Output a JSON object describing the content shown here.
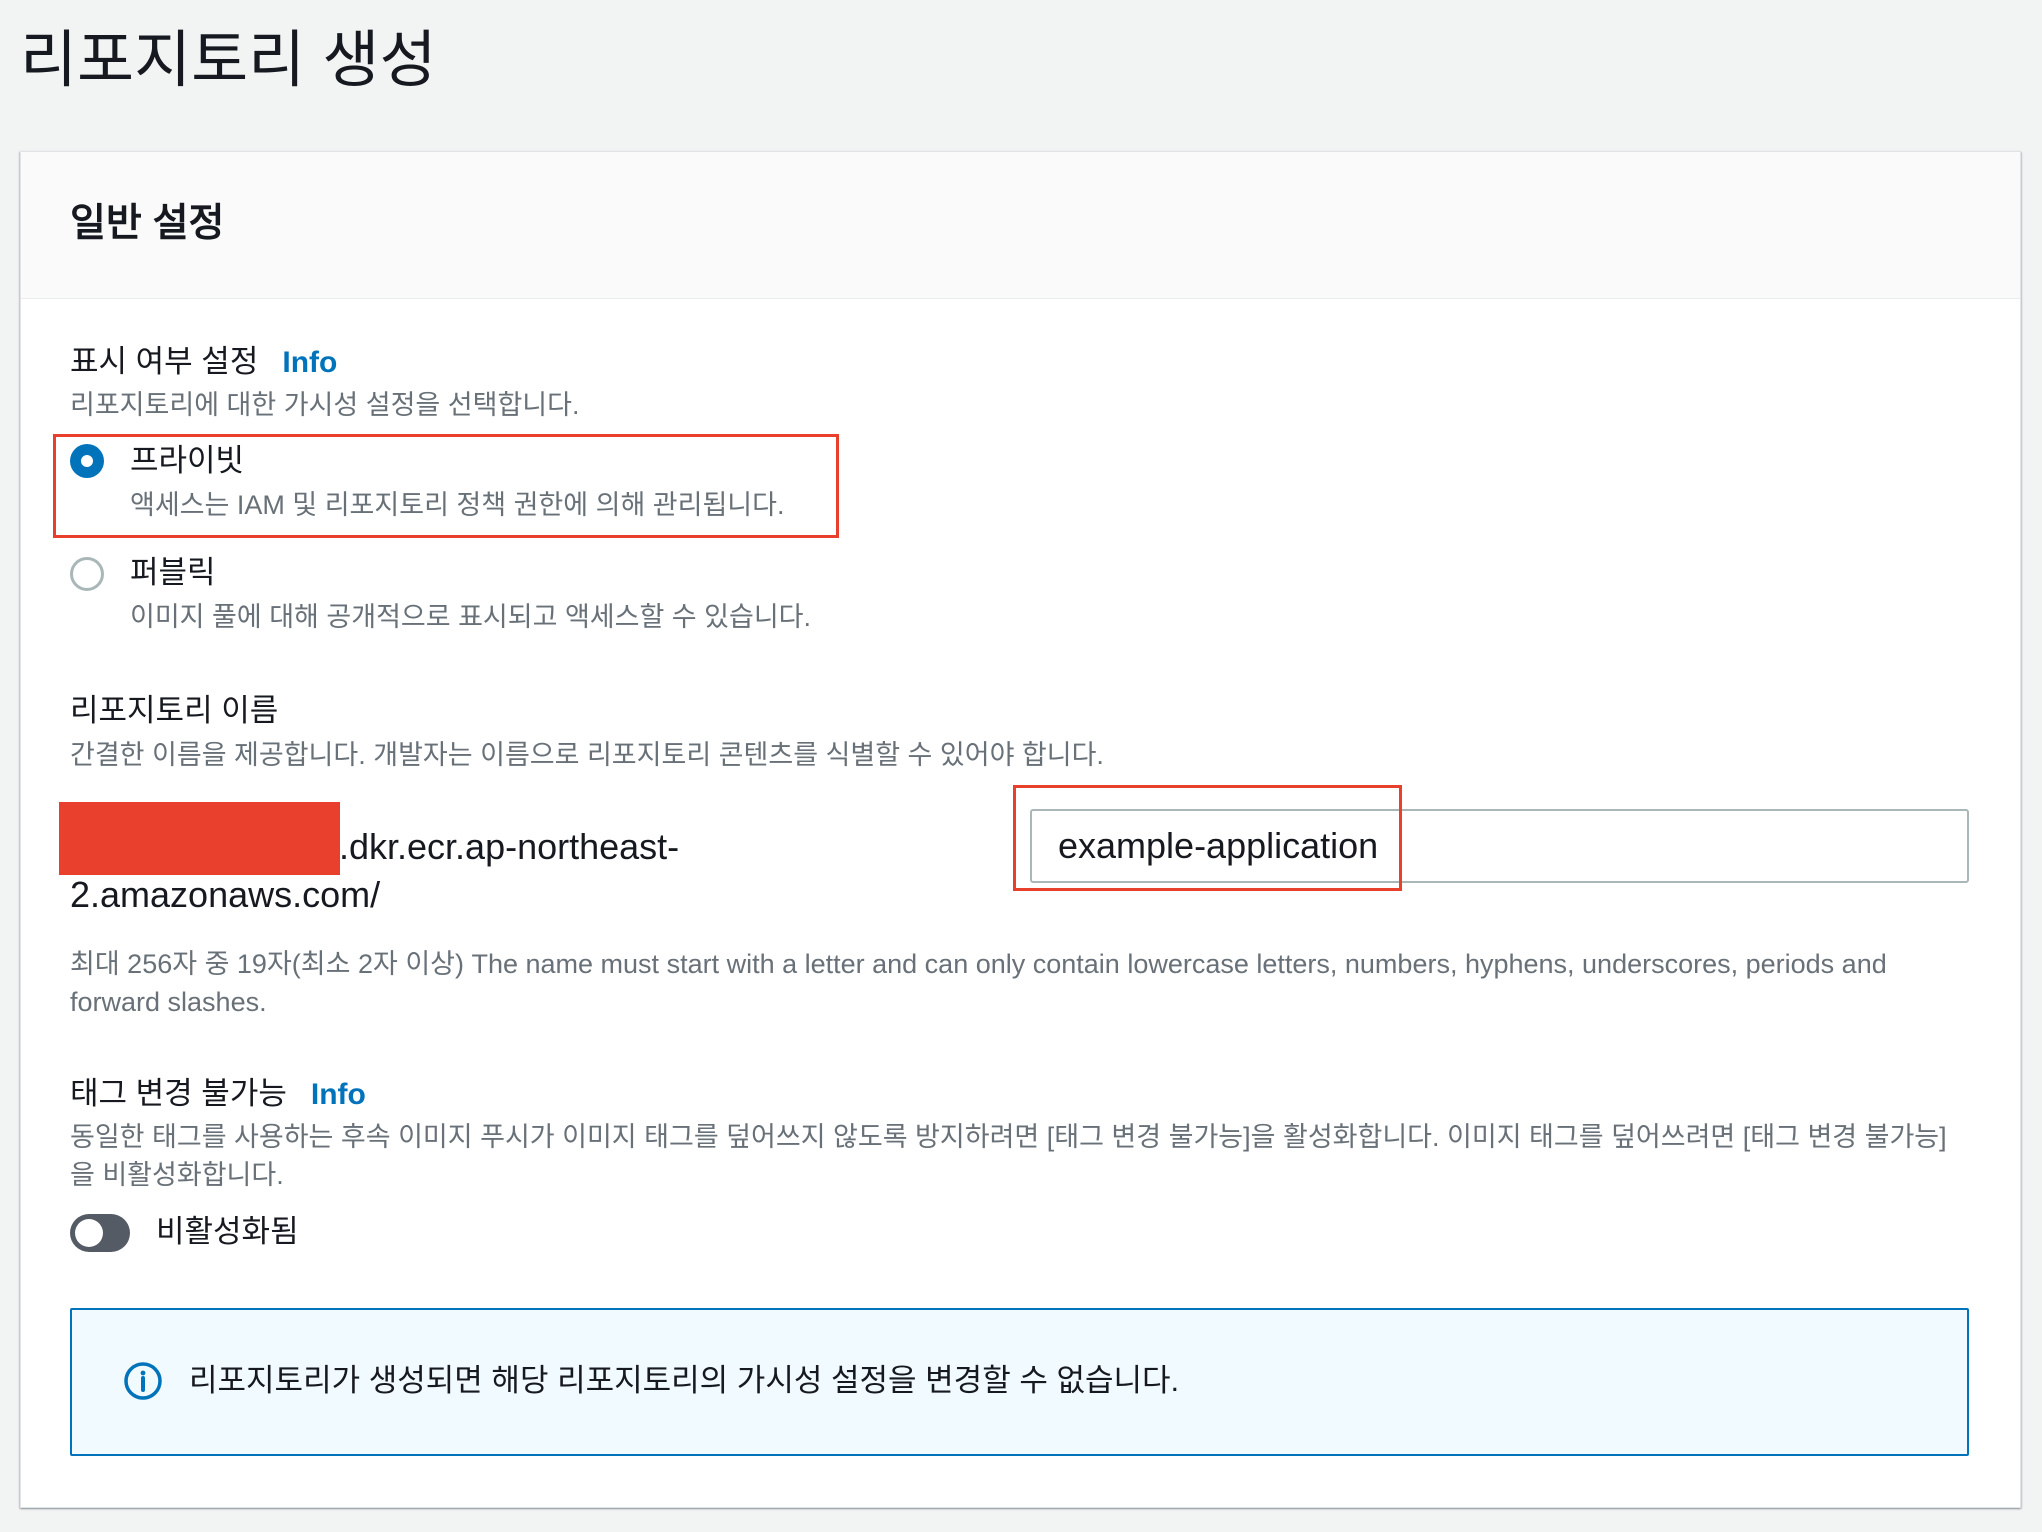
{
  "page": {
    "title": "리포지토리 생성"
  },
  "colors": {
    "accent": "#0073bb",
    "annotation_red": "#e8402c",
    "page_background": "#f2f3f3",
    "alert_background": "#f1faff"
  },
  "general_settings": {
    "header": "일반 설정",
    "visibility": {
      "label": "표시 여부 설정",
      "info_link": "Info",
      "description": "리포지토리에 대한 가시성 설정을 선택합니다.",
      "options": [
        {
          "label": "프라이빗",
          "description": "액세스는 IAM 및 리포지토리 정책 권한에 의해 관리됩니다.",
          "checked": true
        },
        {
          "label": "퍼블릭",
          "description": "이미지 풀에 대해 공개적으로 표시되고 액세스할 수 있습니다.",
          "checked": false
        }
      ]
    },
    "repository_name": {
      "label": "리포지토리 이름",
      "description": "간결한 이름을 제공합니다. 개발자는 이름으로 리포지토리 콘텐츠를 식별할 수 있어야 합니다.",
      "uri_prefix_line1": ".dkr.ecr.ap-northeast-",
      "uri_prefix_line2": "2.amazonaws.com/",
      "value": "example-application",
      "constraint_text": "최대 256자 중 19자(최소 2자 이상) The name must start with a letter and can only contain lowercase letters, numbers, hyphens, underscores, periods and forward slashes."
    },
    "tag_immutability": {
      "label": "태그 변경 불가능",
      "info_link": "Info",
      "description": "동일한 태그를 사용하는 후속 이미지 푸시가 이미지 태그를 덮어쓰지 않도록 방지하려면 [태그 변경 불가능]을 활성화합니다. 이미지 태그를 덮어쓰려면 [태그 변경 불가능]을 비활성화합니다.",
      "enabled": false,
      "state_label": "비활성화됨"
    },
    "alert": {
      "icon": "info-circle-icon",
      "message": "리포지토리가 생성되면 해당 리포지토리의 가시성 설정을 변경할 수 없습니다."
    }
  }
}
